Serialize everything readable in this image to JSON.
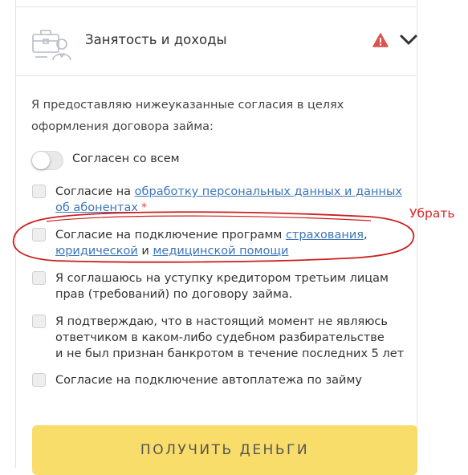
{
  "section": {
    "title": "Занятость и доходы",
    "icon": "briefcase-person-icon",
    "alert_icon": "warning-icon",
    "chevron_icon": "chevron-down-icon",
    "alert_color": "#d9534f"
  },
  "intro": {
    "line1": "Я предоставляю нижеуказанные согласия в целях",
    "line2": "оформления договора займа:"
  },
  "toggle": {
    "label": "Согласен со всем",
    "state": "off"
  },
  "consents": [
    {
      "prefix": "Согласие на ",
      "link1": "обработку персональных данных и данных",
      "link1_cont": "об абонентах",
      "required": "*"
    },
    {
      "prefix": "Согласие на подключение программ ",
      "link_insurance": "страхования",
      "comma": ",",
      "link_legal": "юридической",
      "and": " и ",
      "link_medical": "медицинской помощи"
    },
    {
      "line1": "Я соглашаюсь на уступку кредитором третьим лицам",
      "line2": "прав (требований) по договору займа."
    },
    {
      "line1": "Я подтверждаю, что в настоящий момент не являюсь",
      "line2": "ответчиком в каком-либо судебном разбирательстве",
      "line3": "и не был признан банкротом в течение последних 5 лет"
    },
    {
      "line1": "Согласие на подключение автоплатежа по займу"
    }
  ],
  "annotation": {
    "text": "Убрать",
    "color": "#d92727"
  },
  "submit": {
    "label": "ПОЛУЧИТЬ ДЕНЬГИ",
    "color": "#f9dd6a"
  },
  "colors": {
    "link": "#3b76b8",
    "text": "#333333"
  }
}
